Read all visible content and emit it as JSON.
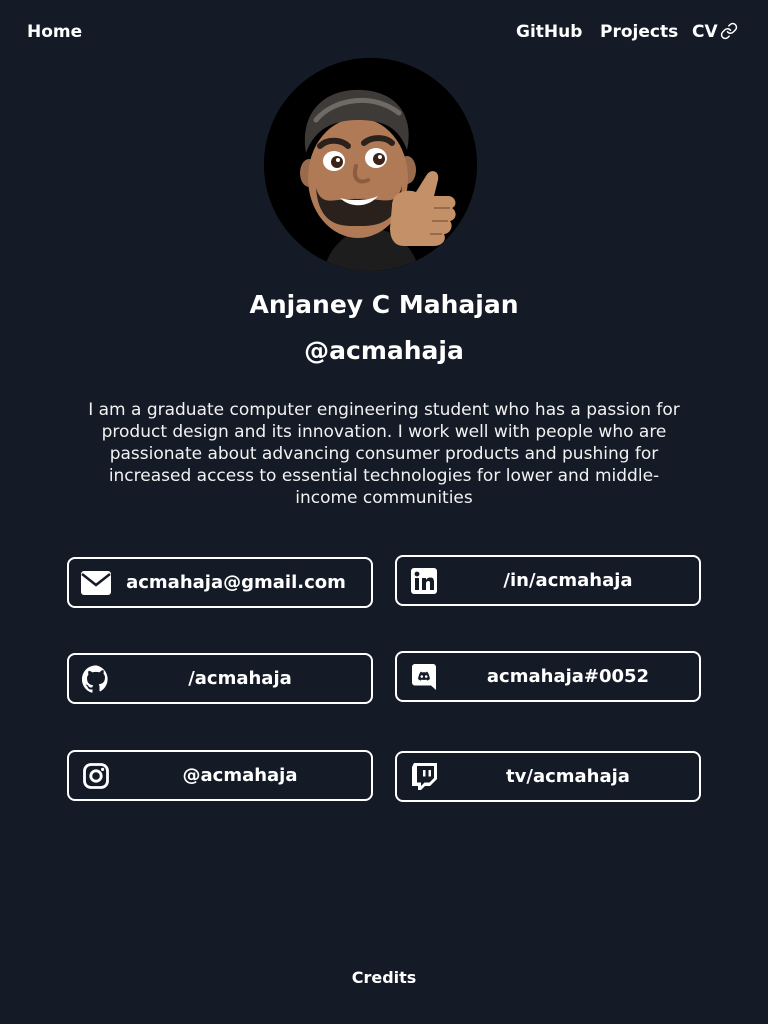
{
  "nav": {
    "home": "Home",
    "github": "GitHub",
    "projects": "Projects",
    "cv": "CV"
  },
  "profile": {
    "name": "Anjaney C Mahajan",
    "handle": "@acmahaja",
    "bio": "I am a graduate computer engineering student who has a passion for product design and its innovation. I work well with people who are passionate about advancing consumer products and pushing for increased access to essential technologies for lower and middle-income communities"
  },
  "contacts": {
    "email": "acmahaja@gmail.com",
    "linkedin": "/in/acmahaja",
    "github": "/acmahaja",
    "discord": "acmahaja#0052",
    "instagram": "@acmahaja",
    "twitch": "tv/acmahaja"
  },
  "footer": {
    "credits": "Credits"
  },
  "icons": {
    "avatar": "memoji-thumbs-up-avatar",
    "email": "envelope-icon",
    "linkedin": "linkedin-icon",
    "github": "github-icon",
    "discord": "discord-icon",
    "instagram": "instagram-icon",
    "twitch": "twitch-icon",
    "cv": "link-icon"
  },
  "colors": {
    "background": "#141a26",
    "foreground": "#ffffff"
  }
}
